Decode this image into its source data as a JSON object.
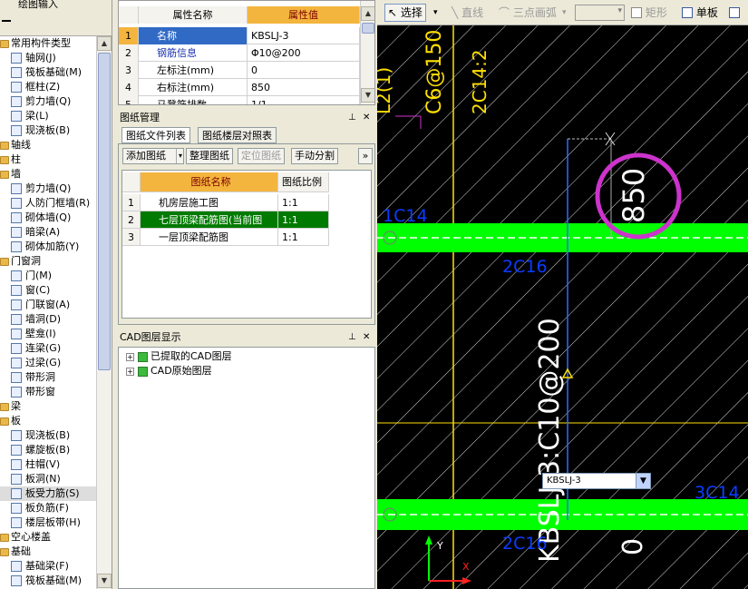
{
  "left_panel": {
    "title": "绘图输入",
    "items": [
      {
        "label": "常用构件类型",
        "folder": true,
        "indent": 0
      },
      {
        "label": "轴网(J)",
        "indent": 1
      },
      {
        "label": "筏板基础(M)",
        "indent": 1
      },
      {
        "label": "框柱(Z)",
        "indent": 1
      },
      {
        "label": "剪力墙(Q)",
        "indent": 1
      },
      {
        "label": "梁(L)",
        "indent": 1
      },
      {
        "label": "现浇板(B)",
        "indent": 1
      },
      {
        "label": "轴线",
        "folder": true,
        "indent": 0
      },
      {
        "label": "柱",
        "folder": true,
        "indent": 0
      },
      {
        "label": "墙",
        "folder": true,
        "indent": 0
      },
      {
        "label": "剪力墙(Q)",
        "indent": 1
      },
      {
        "label": "人防门框墙(R)",
        "indent": 1
      },
      {
        "label": "砌体墙(Q)",
        "indent": 1
      },
      {
        "label": "暗梁(A)",
        "indent": 1
      },
      {
        "label": "砌体加筋(Y)",
        "indent": 1
      },
      {
        "label": "门窗洞",
        "folder": true,
        "indent": 0
      },
      {
        "label": "门(M)",
        "indent": 1
      },
      {
        "label": "窗(C)",
        "indent": 1
      },
      {
        "label": "门联窗(A)",
        "indent": 1
      },
      {
        "label": "墙洞(D)",
        "indent": 1
      },
      {
        "label": "壁龛(I)",
        "indent": 1
      },
      {
        "label": "连梁(G)",
        "indent": 1
      },
      {
        "label": "过梁(G)",
        "indent": 1
      },
      {
        "label": "带形洞",
        "indent": 1
      },
      {
        "label": "带形窗",
        "indent": 1
      },
      {
        "label": "梁",
        "folder": true,
        "indent": 0
      },
      {
        "label": "板",
        "folder": true,
        "indent": 0
      },
      {
        "label": "现浇板(B)",
        "indent": 1
      },
      {
        "label": "螺旋板(B)",
        "indent": 1
      },
      {
        "label": "柱帽(V)",
        "indent": 1
      },
      {
        "label": "板洞(N)",
        "indent": 1
      },
      {
        "label": "板受力筋(S)",
        "indent": 1,
        "selected": true
      },
      {
        "label": "板负筋(F)",
        "indent": 1
      },
      {
        "label": "楼层板带(H)",
        "indent": 1
      },
      {
        "label": "空心楼盖",
        "folder": true,
        "indent": 0
      },
      {
        "label": "基础",
        "folder": true,
        "indent": 0
      },
      {
        "label": "基础梁(F)",
        "indent": 1
      },
      {
        "label": "筏板基础(M)",
        "indent": 1
      }
    ]
  },
  "property_grid": {
    "header_name": "属性名称",
    "header_value": "属性值",
    "rows": [
      {
        "num": "1",
        "name": "名称",
        "value": "KBSLJ-3",
        "selected": true
      },
      {
        "num": "2",
        "name": "钢筋信息",
        "value": "Φ10@200",
        "blue": true
      },
      {
        "num": "3",
        "name": "左标注(mm)",
        "value": "0"
      },
      {
        "num": "4",
        "name": "右标注(mm)",
        "value": "850"
      },
      {
        "num": "5",
        "name": "马凳筋排数",
        "value": "1/1"
      }
    ]
  },
  "drawing_mgmt": {
    "title": "图纸管理",
    "tabs": [
      "图纸文件列表",
      "图纸楼层对照表"
    ],
    "buttons": {
      "add": "添加图纸",
      "arrange": "整理图纸",
      "locate": "定位图纸",
      "split": "手动分割",
      "more": "»"
    },
    "headers": {
      "name": "图纸名称",
      "scale": "图纸比例"
    },
    "rows": [
      {
        "num": "1",
        "name": "机房层施工图",
        "scale": "1:1"
      },
      {
        "num": "2",
        "name": "七层顶梁配筋图(当前图",
        "scale": "1:1",
        "current": true
      },
      {
        "num": "3",
        "name": "一层顶梁配筋图",
        "scale": "1:1"
      }
    ]
  },
  "cad_layers": {
    "title": "CAD图层显示",
    "items": [
      "已提取的CAD图层",
      "CAD原始图层"
    ]
  },
  "toolbar": {
    "select": "选择",
    "line": "直线",
    "arc": "三点画弧",
    "rect": "矩形",
    "single": "单板"
  },
  "canvas": {
    "annotations": {
      "top_1": "L2(1)",
      "top_2": "C6@150",
      "top_3": "2C14:2",
      "dim_850": "850",
      "rebar_1c14": "1C14",
      "rebar_2c16_a": "2C16",
      "rebar_main": "KBSLJ-3:C10@200",
      "dim_0": "0",
      "rebar_3c14": "3C14",
      "rebar_2c16_b": "2C16",
      "axis_y": "Y",
      "axis_x": "X"
    },
    "combo_value": "KBSLJ-3",
    "colors": {
      "beam": "#00ff00",
      "rebar_text": "#0a3cff",
      "axis_text": "#ffe000",
      "highlight": "#cc33cc"
    }
  }
}
